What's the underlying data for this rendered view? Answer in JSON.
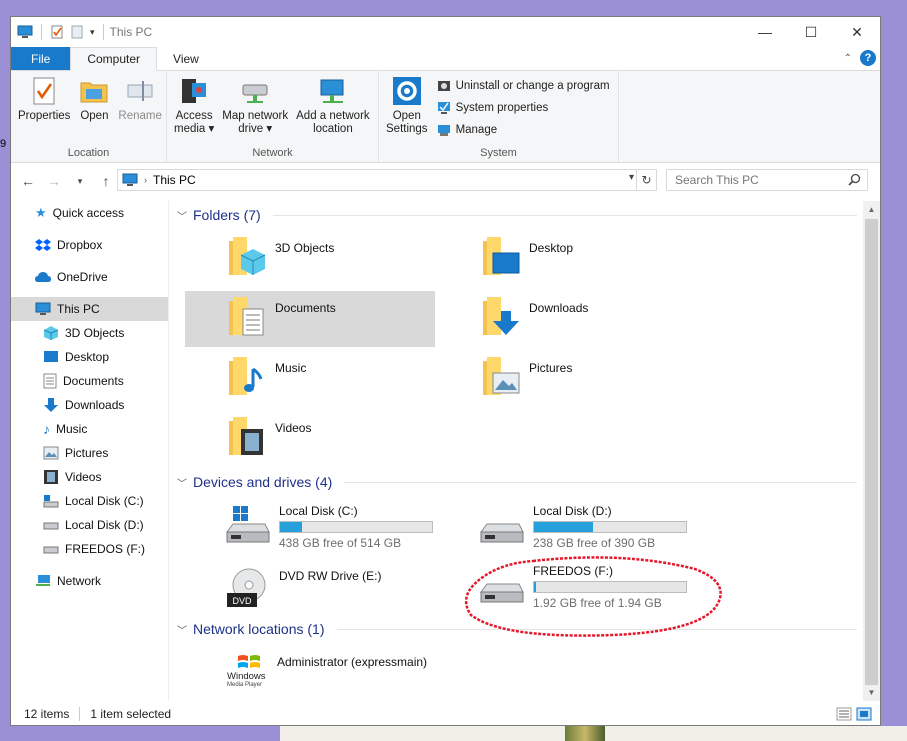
{
  "window": {
    "title": "This PC",
    "minimize": "—",
    "maximize": "☐",
    "close": "✕"
  },
  "left_fragment": "9",
  "tabs": [
    {
      "label": "File"
    },
    {
      "label": "Computer"
    },
    {
      "label": "View"
    }
  ],
  "ribbon": {
    "location": {
      "label": "Location",
      "properties": "Properties",
      "open": "Open",
      "rename": "Rename"
    },
    "network": {
      "label": "Network",
      "access_media_1": "Access",
      "access_media_2": "media ▾",
      "map_drive_1": "Map network",
      "map_drive_2": "drive ▾",
      "add_location_1": "Add a network",
      "add_location_2": "location"
    },
    "system": {
      "label": "System",
      "open_settings_1": "Open",
      "open_settings_2": "Settings",
      "uninstall": "Uninstall or change a program",
      "system_properties": "System properties",
      "manage": "Manage"
    }
  },
  "address": {
    "path": "This PC",
    "search_placeholder": "Search This PC"
  },
  "nav": {
    "quick_access": "Quick access",
    "dropbox": "Dropbox",
    "onedrive": "OneDrive",
    "this_pc": "This PC",
    "children": [
      "3D Objects",
      "Desktop",
      "Documents",
      "Downloads",
      "Music",
      "Pictures",
      "Videos",
      "Local Disk (C:)",
      "Local Disk (D:)",
      "FREEDOS (F:)"
    ],
    "network": "Network"
  },
  "sections": {
    "folders": "Folders (7)",
    "devices": "Devices and drives (4)",
    "network_locations": "Network locations (1)"
  },
  "folders": [
    "3D Objects",
    "Desktop",
    "Documents",
    "Downloads",
    "Music",
    "Pictures",
    "Videos"
  ],
  "drives": [
    {
      "name": "Local Disk (C:)",
      "free": "438 GB free of 514 GB",
      "used_fraction": 0.148
    },
    {
      "name": "Local Disk (D:)",
      "free": "238 GB free of 390 GB",
      "used_fraction": 0.39
    },
    {
      "name": "DVD RW Drive (E:)",
      "free": ""
    },
    {
      "name": "FREEDOS (F:)",
      "free": "1.92 GB free of 1.94 GB",
      "used_fraction": 0.01
    }
  ],
  "dvd_label": "DVD",
  "network_location": {
    "name": "Administrator (expressmain)",
    "logo_1": "Windows",
    "logo_2": "Media Player"
  },
  "status": {
    "items": "12 items",
    "selected": "1 item selected"
  },
  "colors": {
    "accent": "#1979ca",
    "bar_fill": "#26a0da",
    "selection": "#d9d9d9",
    "highlight_circle": "#e5172b"
  }
}
